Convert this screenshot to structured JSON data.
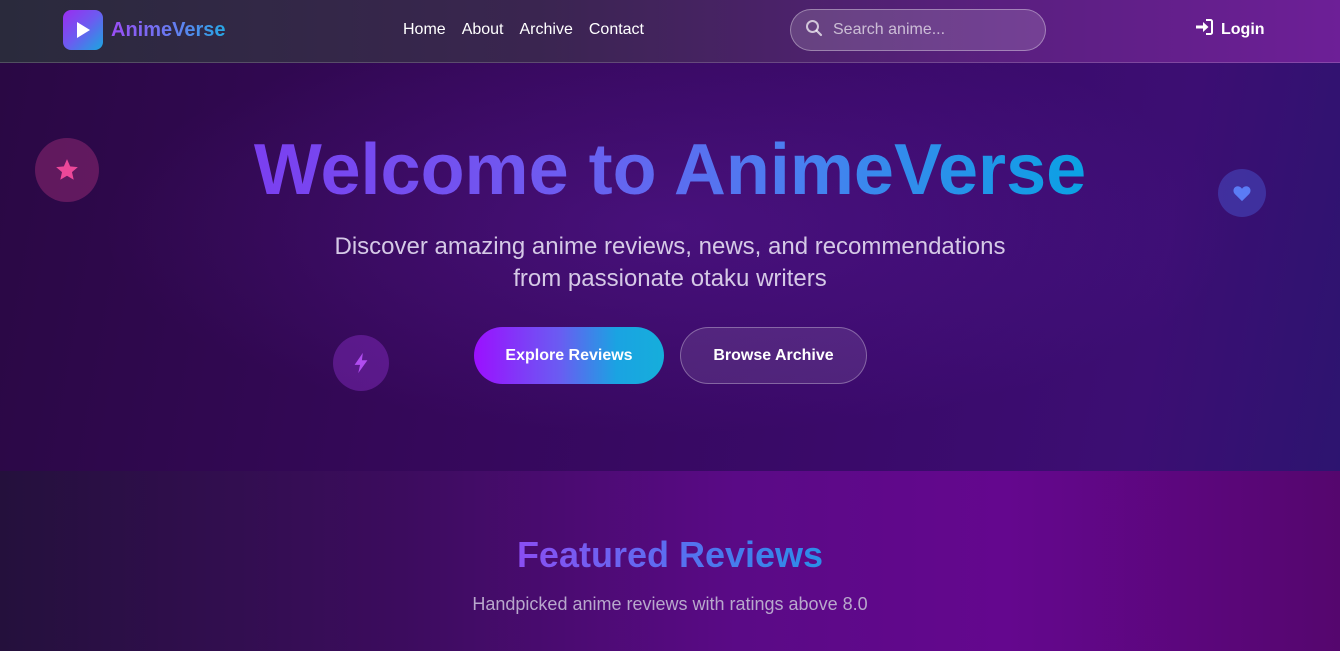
{
  "nav": {
    "brand": "AnimeVerse",
    "links": [
      "Home",
      "About",
      "Archive",
      "Contact"
    ],
    "search_placeholder": "Search anime...",
    "login_label": "Login",
    "icons": {
      "logo": "play-icon",
      "search": "search-icon",
      "login": "sign-in-icon"
    }
  },
  "hero": {
    "title": "Welcome to AnimeVerse",
    "subtitle_line1": "Discover amazing anime reviews, news, and recommendations",
    "subtitle_line2": "from passionate otaku writers",
    "primary_button": "Explore Reviews",
    "secondary_button": "Browse Archive",
    "floating_icons": [
      "star-icon",
      "heart-icon",
      "bolt-icon"
    ]
  },
  "featured": {
    "title": "Featured Reviews",
    "subtitle": "Handpicked anime reviews with ratings above 8.0"
  },
  "colors": {
    "accent_purple": "#9b10ff",
    "accent_blue": "#1aa3e2",
    "star_pink": "#ec4899",
    "heart_blue": "#5b7cf5",
    "bolt_purple": "#b04cf0"
  }
}
